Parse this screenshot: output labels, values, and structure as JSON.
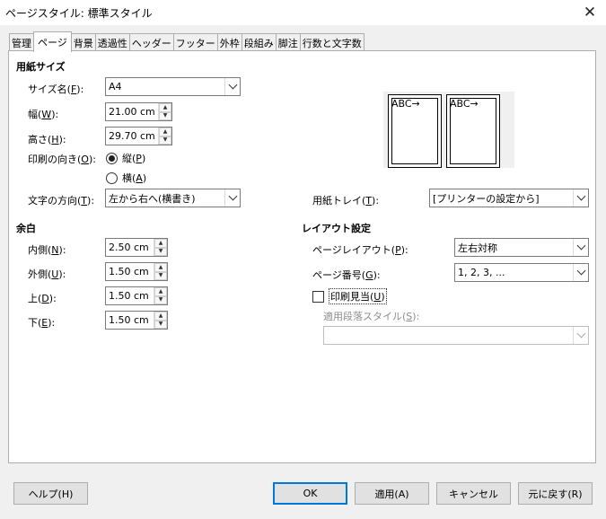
{
  "window": {
    "title": "ページスタイル: 標準スタイル"
  },
  "tabs": [
    {
      "label": "管理",
      "active": false
    },
    {
      "label": "ページ",
      "active": true
    },
    {
      "label": "背景",
      "active": false
    },
    {
      "label": "透過性",
      "active": false
    },
    {
      "label": "ヘッダー",
      "active": false
    },
    {
      "label": "フッター",
      "active": false
    },
    {
      "label": "外枠",
      "active": false
    },
    {
      "label": "段組み",
      "active": false
    },
    {
      "label": "脚注",
      "active": false
    },
    {
      "label": "行数と文字数",
      "active": false
    }
  ],
  "paper": {
    "section_title": "用紙サイズ",
    "size_label": "サイズ名(",
    "size_key": "F",
    "size_label_end": "):",
    "size_value": "A4",
    "width_label": "幅(",
    "width_key": "W",
    "width_label_end": "):",
    "width_value": "21.00 cm",
    "height_label": "高さ(",
    "height_key": "H",
    "height_label_end": "):",
    "height_value": "29.70 cm",
    "orientation_label": "印刷の向き(",
    "orientation_key": "O",
    "orientation_label_end": "):",
    "portrait_label": "縦(",
    "portrait_key": "P",
    "portrait_label_end": ")",
    "landscape_label": "横(",
    "landscape_key": "A",
    "landscape_label_end": ")",
    "orientation_selected": "portrait",
    "text_dir_label": "文字の方向(",
    "text_dir_key": "T",
    "text_dir_label_end": "):",
    "text_dir_value": "左から右へ(横書き)",
    "tray_label": "用紙トレイ(",
    "tray_key": "T",
    "tray_label_end": "):",
    "tray_value": "[プリンターの設定から]"
  },
  "preview": {
    "page_text": "ABC→"
  },
  "margins": {
    "section_title": "余白",
    "inner_label": "内側(",
    "inner_key": "N",
    "inner_label_end": "):",
    "inner_value": "2.50 cm",
    "outer_label": "外側(",
    "outer_key": "U",
    "outer_label_end": "):",
    "outer_value": "1.50 cm",
    "top_label": "上(",
    "top_key": "D",
    "top_label_end": "):",
    "top_value": "1.50 cm",
    "bottom_label": "下(",
    "bottom_key": "E",
    "bottom_label_end": "):",
    "bottom_value": "1.50 cm"
  },
  "layout": {
    "section_title": "レイアウト設定",
    "page_layout_label": "ページレイアウト(",
    "page_layout_key": "P",
    "page_layout_label_end": "):",
    "page_layout_value": "左右対称",
    "page_number_label": "ページ番号(",
    "page_number_key": "G",
    "page_number_label_end": "):",
    "page_number_value": "1, 2, 3, ...",
    "register_label": "印刷見当(",
    "register_key": "U",
    "register_label_end": ")",
    "register_checked": false,
    "para_style_label": "適用段落スタイル(",
    "para_style_key": "S",
    "para_style_label_end": "):",
    "para_style_value": ""
  },
  "buttons": {
    "help": "ヘルプ(H)",
    "ok": "OK",
    "apply": "適用(A)",
    "cancel": "キャンセル",
    "reset": "元に戻す(R)"
  },
  "icons": {
    "close": "close-icon",
    "dropdown": "chevron-down-icon",
    "spin_up": "triangle-up",
    "spin_down": "triangle-down"
  }
}
